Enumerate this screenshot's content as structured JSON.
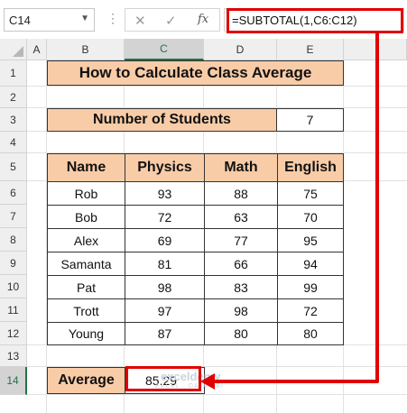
{
  "formula_bar": {
    "name_box": "C14",
    "formula": "=SUBTOTAL(1,C6:C12)",
    "cancel_symbol": "✕",
    "enter_symbol": "✓",
    "fx_symbol": "fx",
    "more_symbol": "⋮"
  },
  "columns": [
    "A",
    "B",
    "C",
    "D",
    "E"
  ],
  "rows": [
    "1",
    "2",
    "3",
    "4",
    "5",
    "6",
    "7",
    "8",
    "9",
    "10",
    "11",
    "12",
    "13",
    "14"
  ],
  "sheet": {
    "title": "How to Calculate Class Average",
    "count_label": "Number of Students",
    "count_value": "7",
    "table": {
      "headers": [
        "Name",
        "Physics",
        "Math",
        "English"
      ],
      "rows": [
        [
          "Rob",
          "93",
          "88",
          "75"
        ],
        [
          "Bob",
          "72",
          "63",
          "70"
        ],
        [
          "Alex",
          "69",
          "77",
          "95"
        ],
        [
          "Samanta",
          "81",
          "66",
          "94"
        ],
        [
          "Pat",
          "98",
          "83",
          "99"
        ],
        [
          "Trott",
          "97",
          "98",
          "72"
        ],
        [
          "Young",
          "87",
          "80",
          "80"
        ]
      ]
    },
    "average_label": "Average",
    "average_value": "85.29"
  },
  "watermark": {
    "brand": "exceldemy",
    "tagline": "EXCEL · DATA · BI"
  },
  "colors": {
    "header_fill": "#f9cca8",
    "highlight": "#e00000",
    "selected_header": "#217346"
  }
}
